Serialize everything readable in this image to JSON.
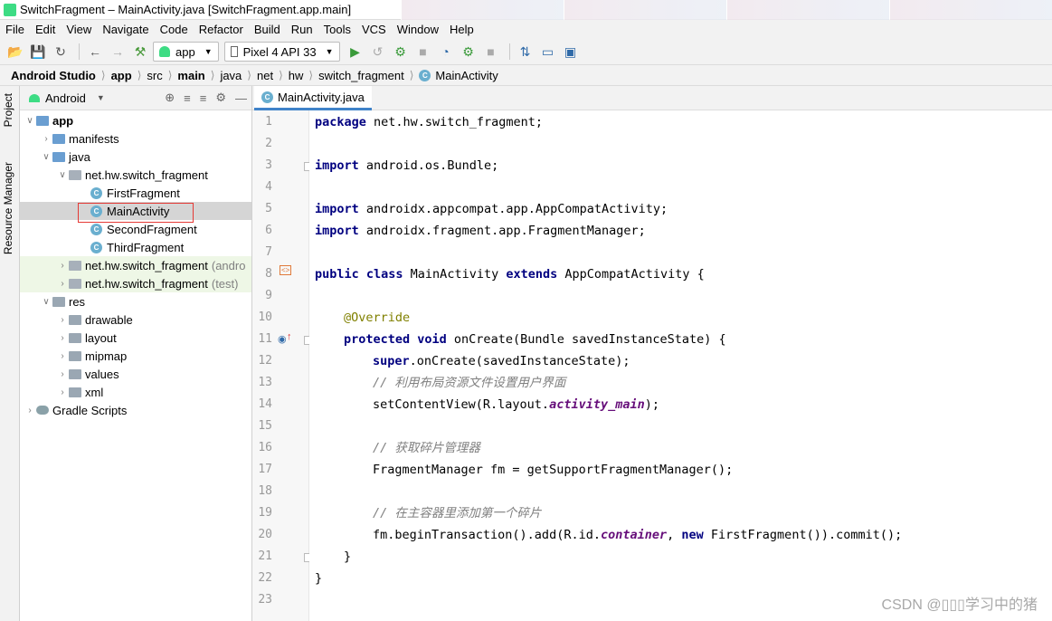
{
  "window": {
    "title": "SwitchFragment – MainActivity.java [SwitchFragment.app.main]"
  },
  "menu": [
    "File",
    "Edit",
    "View",
    "Navigate",
    "Code",
    "Refactor",
    "Build",
    "Run",
    "Tools",
    "VCS",
    "Window",
    "Help"
  ],
  "toolbar": {
    "config": "app",
    "device": "Pixel 4 API 33"
  },
  "breadcrumb": [
    "Android Studio",
    "app",
    "src",
    "main",
    "java",
    "net",
    "hw",
    "switch_fragment",
    "MainActivity"
  ],
  "side_tabs": {
    "project": "Project",
    "resource_manager": "Resource Manager"
  },
  "project_panel": {
    "view_mode": "Android",
    "tree": [
      {
        "label": "app",
        "extra": ""
      },
      {
        "label": "manifests",
        "extra": ""
      },
      {
        "label": "java",
        "extra": ""
      },
      {
        "label": "net.hw.switch_fragment",
        "extra": ""
      },
      {
        "label": "FirstFragment",
        "extra": ""
      },
      {
        "label": "MainActivity",
        "extra": ""
      },
      {
        "label": "SecondFragment",
        "extra": ""
      },
      {
        "label": "ThirdFragment",
        "extra": ""
      },
      {
        "label": "net.hw.switch_fragment",
        "extra": "(andro"
      },
      {
        "label": "net.hw.switch_fragment",
        "extra": "(test)"
      },
      {
        "label": "res",
        "extra": ""
      },
      {
        "label": "drawable",
        "extra": ""
      },
      {
        "label": "layout",
        "extra": ""
      },
      {
        "label": "mipmap",
        "extra": ""
      },
      {
        "label": "values",
        "extra": ""
      },
      {
        "label": "xml",
        "extra": ""
      },
      {
        "label": "Gradle Scripts",
        "extra": ""
      }
    ]
  },
  "editor": {
    "tab": "MainActivity.java",
    "line_numbers": [
      "1",
      "2",
      "3",
      "4",
      "5",
      "6",
      "7",
      "8",
      "9",
      "10",
      "11",
      "12",
      "13",
      "14",
      "15",
      "16",
      "17",
      "18",
      "19",
      "20",
      "21",
      "22",
      "23"
    ],
    "code": {
      "l1_kw": "package",
      "l1_rest": " net.hw.switch_fragment;",
      "l3_kw": "import",
      "l3_rest": " android.os.Bundle;",
      "l5_kw": "import",
      "l5_rest": " androidx.appcompat.app.AppCompatActivity;",
      "l6_kw": "import",
      "l6_rest": " androidx.fragment.app.FragmentManager;",
      "l8_kw1": "public class",
      "l8_mid": " MainActivity ",
      "l8_kw2": "extends",
      "l8_rest": " AppCompatActivity {",
      "l10_ann": "@Override",
      "l11_kw": "protected void",
      "l11_rest": " onCreate(Bundle savedInstanceState) {",
      "l12_kw": "super",
      "l12_rest": ".onCreate(savedInstanceState);",
      "l13_cm": "// 利用布局资源文件设置用户界面",
      "l14_a": "setContentView(R.layout.",
      "l14_fld": "activity_main",
      "l14_b": ");",
      "l16_cm": "// 获取碎片管理器",
      "l17": "FragmentManager fm = getSupportFragmentManager();",
      "l19_cm": "// 在主容器里添加第一个碎片",
      "l20_a": "fm.beginTransaction().add(R.id.",
      "l20_fld": "container",
      "l20_b": ", ",
      "l20_kw": "new",
      "l20_c": " FirstFragment()).commit();",
      "l21": "}",
      "l22": "}"
    }
  },
  "watermark": "CSDN @▯▯▯学习中的猪"
}
